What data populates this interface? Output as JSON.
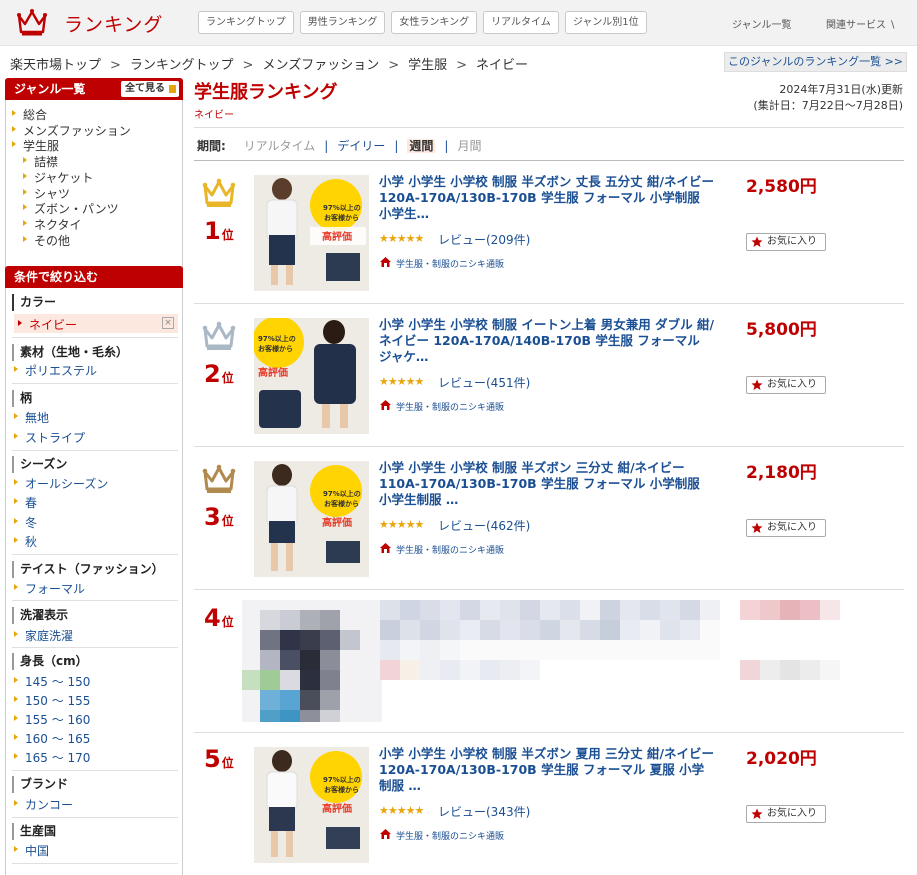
{
  "header": {
    "logo_text": "ランキング",
    "nav": [
      "ランキングトップ",
      "男性ランキング",
      "女性ランキング",
      "リアルタイム",
      "ジャンル別1位"
    ],
    "genre_list": "ジャンル一覧",
    "related": "関連サービス ∖"
  },
  "breadcrumb": [
    "楽天市場トップ",
    "ランキングトップ",
    "メンズファッション",
    "学生服",
    "ネイビー"
  ],
  "breadcrumb_sep": ">",
  "genre_ranking_link": "このジャンルのランキング一覧 >>",
  "sidebar": {
    "genre_head": "ジャンル一覧",
    "see_all": "全て見る",
    "genres": [
      "総合",
      "メンズファッション",
      "学生服"
    ],
    "subgenres": [
      "詰襟",
      "ジャケット",
      "シャツ",
      "ズボン・パンツ",
      "ネクタイ",
      "その他"
    ],
    "filter_head": "条件で絞り込む",
    "filters": {
      "color": {
        "head": "カラー",
        "selected": "ネイビー",
        "clear": "×"
      },
      "material": {
        "head": "素材（生地・毛糸）",
        "items": [
          "ポリエステル"
        ]
      },
      "pattern": {
        "head": "柄",
        "items": [
          "無地",
          "ストライプ"
        ]
      },
      "season": {
        "head": "シーズン",
        "items": [
          "オールシーズン",
          "春",
          "冬",
          "秋"
        ]
      },
      "taste": {
        "head": "テイスト（ファッション）",
        "items": [
          "フォーマル"
        ]
      },
      "wash": {
        "head": "洗濯表示",
        "items": [
          "家庭洗濯"
        ]
      },
      "height": {
        "head": "身長（cm）",
        "items": [
          "145 ～ 150",
          "150 ～ 155",
          "155 ～ 160",
          "160 ～ 165",
          "165 ～ 170"
        ]
      },
      "brand": {
        "head": "ブランド",
        "items": [
          "カンコー"
        ]
      },
      "origin": {
        "head": "生産国",
        "items": [
          "中国"
        ]
      }
    }
  },
  "main": {
    "title": "学生服ランキング",
    "subtitle": "ネイビー",
    "updated": "2024年7月31日(水)更新",
    "period_range": "(集計日：7月22日～7月28日)",
    "period_label": "期間:",
    "period_options": [
      "リアルタイム",
      "デイリー",
      "週間",
      "月間"
    ],
    "fav_label": "お気に入り",
    "rank_suffix": "位",
    "items": [
      {
        "rank": "1",
        "title": "小学 小学生 小学校 制服 半ズボン 丈長 五分丈 紺/ネイビー 120A-170A/130B-170B 学生服 フォーマル 小学制服 小学生…",
        "stars": "★★★★★",
        "review": "レビュー(209件)",
        "shop": "学生服・制服のニシキ通販",
        "price": "2,580円",
        "crown_color": "#e8b628"
      },
      {
        "rank": "2",
        "title": "小学 小学生 小学校 制服 イートン上着 男女兼用 ダブル 紺/ネイビー 120A-170A/140B-170B 学生服 フォーマル ジャケ…",
        "stars": "★★★★★",
        "review": "レビュー(451件)",
        "shop": "学生服・制服のニシキ通販",
        "price": "5,800円",
        "crown_color": "#aab8c6"
      },
      {
        "rank": "3",
        "title": "小学 小学生 小学校 制服 半ズボン 三分丈 紺/ネイビー 110A-170A/130B-170B 学生服 フォーマル 小学制服 小学生制服 …",
        "stars": "★★★★★",
        "review": "レビュー(462件)",
        "shop": "学生服・制服のニシキ通販",
        "price": "2,180円",
        "crown_color": "#b08a4e"
      },
      {
        "rank": "4"
      },
      {
        "rank": "5",
        "title": "小学 小学生 小学校 制服 半ズボン 夏用 三分丈 紺/ネイビー 120A-170A/130B-170B 学生服 フォーマル 夏服 小学制服 …",
        "stars": "★★★★★",
        "review": "レビュー(343件)",
        "shop": "学生服・制服のニシキ通販",
        "price": "2,020円"
      }
    ],
    "thumb_badge": {
      "line1": "97%以上の",
      "line2": "お客様から",
      "line3": "高評価"
    }
  }
}
